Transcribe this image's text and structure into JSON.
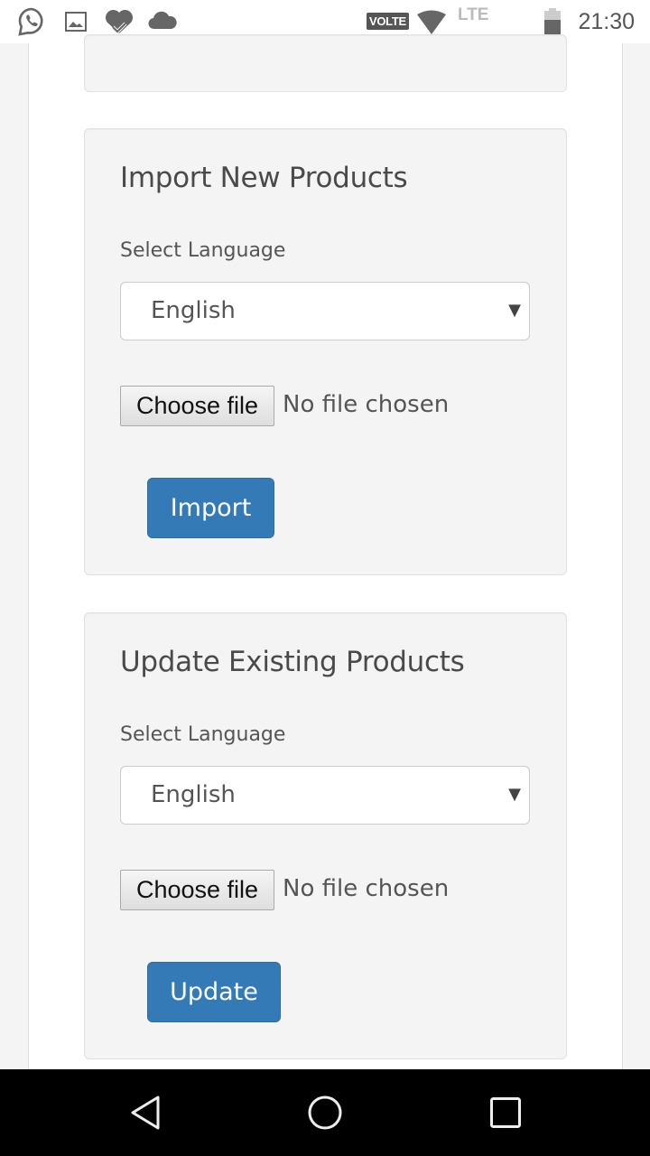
{
  "status_bar": {
    "left_icons": [
      "whatsapp-icon",
      "gallery-icon",
      "health-icon",
      "cloud-icon"
    ],
    "volte": "VOLTE",
    "network": "LTE",
    "time": "21:30"
  },
  "import_card": {
    "title": "Import New Products",
    "language_label": "Select Language",
    "language_value": "English",
    "file_button": "Choose file",
    "file_status": "No file chosen",
    "submit_label": "Import"
  },
  "update_card": {
    "title": "Update Existing Products",
    "language_label": "Select Language",
    "language_value": "English",
    "file_button": "Choose file",
    "file_status": "No file chosen",
    "submit_label": "Update"
  },
  "colors": {
    "primary": "#337ab7",
    "card_bg": "#f4f4f4"
  }
}
